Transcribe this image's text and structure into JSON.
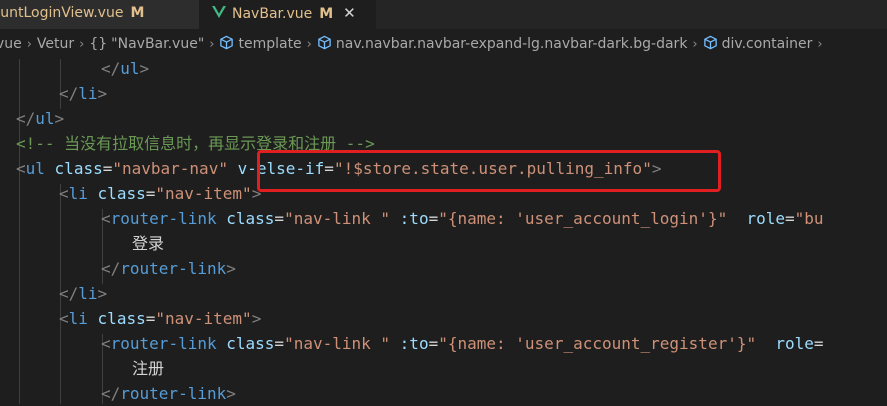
{
  "tabs": [
    {
      "name": "countLoginView.vue",
      "status": "M"
    },
    {
      "name": "NavBar.vue",
      "status": "M",
      "close": "✕"
    }
  ],
  "breadcrumb": {
    "file": "r.vue",
    "vetur": "Vetur",
    "component": "\"NavBar.vue\"",
    "template": "template",
    "nav": "nav.navbar.navbar-expand-lg.navbar-dark.bg-dark",
    "div": "div.container"
  },
  "code": {
    "l1": {
      "close_open": "</",
      "tag": "ul",
      "end": ">"
    },
    "l2": {
      "close_open": "</",
      "tag": "li",
      "end": ">"
    },
    "l3": {
      "close_open": "</",
      "tag": "ul",
      "end": ">"
    },
    "l4": {
      "comment": "<!-- 当没有拉取信息时，再显示登录和注册 -->"
    },
    "l5": {
      "open": "<",
      "tag": "ul",
      "attr1": "class",
      "eq1": "=",
      "val1": "\"navbar-nav\"",
      "attr2": "v-else-if",
      "eq2": "=",
      "val2": "\"!$store.state.user.pulling_info\"",
      "end": ">"
    },
    "l6": {
      "open": "<",
      "tag": "li",
      "attr1": "class",
      "eq1": "=",
      "val1": "\"nav-item\"",
      "end": ">"
    },
    "l7": {
      "open": "<",
      "tag": "router-link",
      "attr1": "class",
      "eq1": "=",
      "val1": "\"nav-link \"",
      "attr2": ":to",
      "eq2": "=",
      "val2": "\"{name: 'user_account_login'}\"",
      "attr3": "role",
      "eq3": "=",
      "val3": "\"bu"
    },
    "l8": {
      "text": "登录"
    },
    "l9": {
      "close_open": "</",
      "tag": "router-link",
      "end": ">"
    },
    "l10": {
      "close_open": "</",
      "tag": "li",
      "end": ">"
    },
    "l11": {
      "open": "<",
      "tag": "li",
      "attr1": "class",
      "eq1": "=",
      "val1": "\"nav-item\"",
      "end": ">"
    },
    "l12": {
      "open": "<",
      "tag": "router-link",
      "attr1": "class",
      "eq1": "=",
      "val1": "\"nav-link \"",
      "attr2": ":to",
      "eq2": "=",
      "val2": "\"{name: 'user_account_register'}\"",
      "attr3": "role",
      "eq3": "="
    },
    "l13": {
      "text": "注册"
    },
    "l14": {
      "close_open": "</",
      "tag": "router-link",
      "end": ">"
    }
  },
  "colors": {
    "background": "#1e1e1e",
    "tag": "#569cd6",
    "attribute": "#9cdcfe",
    "string": "#ce9178",
    "comment": "#6a9955",
    "modified": "#e2c08d",
    "highlight_box": "#e02020"
  }
}
